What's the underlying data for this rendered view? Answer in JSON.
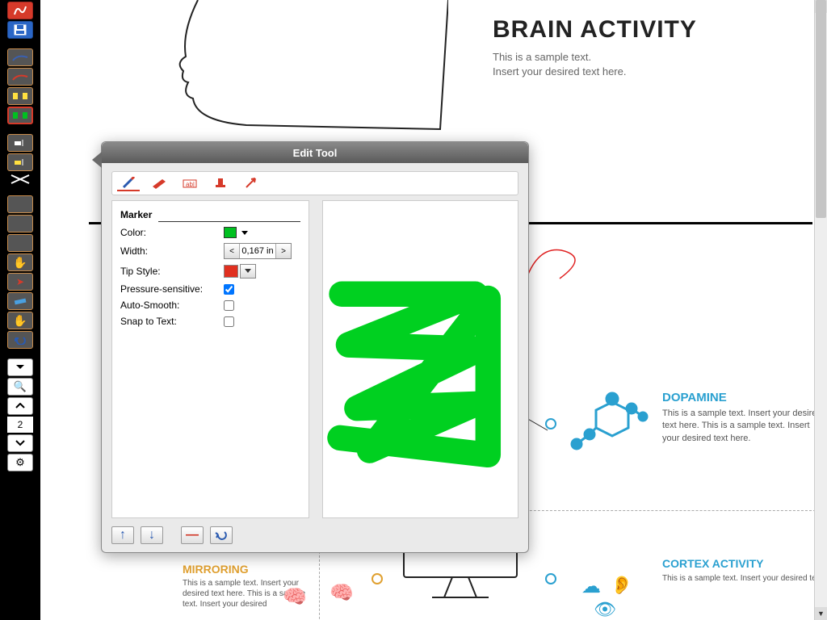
{
  "toolbar": {
    "page_number": "2"
  },
  "document": {
    "title": "BRAIN ACTIVITY",
    "subtitle_line1": "This is a sample text.",
    "subtitle_line2": "Insert your desired text here.",
    "dopamine": {
      "heading": "DOPAMINE",
      "body": "This is a sample text. Insert your desired text here. This is a sample text. Insert your desired text here."
    },
    "mirroring": {
      "heading": "MIRRORING",
      "body": "This is a sample text. Insert your desired text here. This is a sample text. Insert your desired"
    },
    "cortex": {
      "heading": "CORTEX ACTIVITY",
      "body": "This is a sample text. Insert your desired text"
    }
  },
  "dialog": {
    "title": "Edit Tool",
    "section": "Marker",
    "labels": {
      "color": "Color:",
      "width": "Width:",
      "tip_style": "Tip Style:",
      "pressure": "Pressure-sensitive:",
      "auto_smooth": "Auto-Smooth:",
      "snap": "Snap to Text:"
    },
    "values": {
      "color": "#00c020",
      "width": "0,167 in",
      "tip_color": "#e03020",
      "pressure_checked": true,
      "auto_smooth_checked": false,
      "snap_checked": false
    }
  }
}
